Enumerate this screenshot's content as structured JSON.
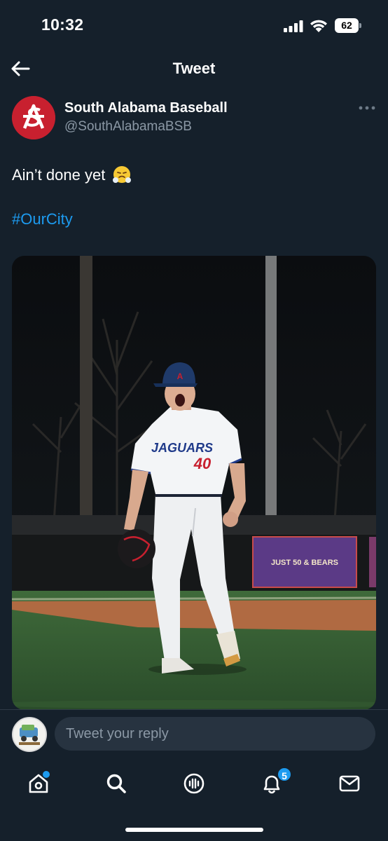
{
  "status_bar": {
    "time": "10:32",
    "battery": "62"
  },
  "header": {
    "title": "Tweet"
  },
  "author": {
    "name": "South Alabama Baseball",
    "handle": "@SouthAlabamaBSB"
  },
  "tweet": {
    "text": "Ain’t done yet",
    "emoji": "face-with-steam-icon",
    "hashtag": "#OurCity"
  },
  "photo": {
    "jersey_name": "JAGUARS",
    "jersey_number": "40",
    "banner_text": "JUST 50 & BEARS"
  },
  "reply": {
    "placeholder": "Tweet your reply"
  },
  "nav": {
    "items": [
      "home-icon",
      "search-icon",
      "spaces-icon",
      "notifications-icon",
      "messages-icon"
    ],
    "notification_count": "5"
  },
  "colors": {
    "background": "#15202b",
    "accent": "#1d9bf0",
    "secondary_text": "#8b98a5",
    "brand_red": "#c8202f"
  }
}
